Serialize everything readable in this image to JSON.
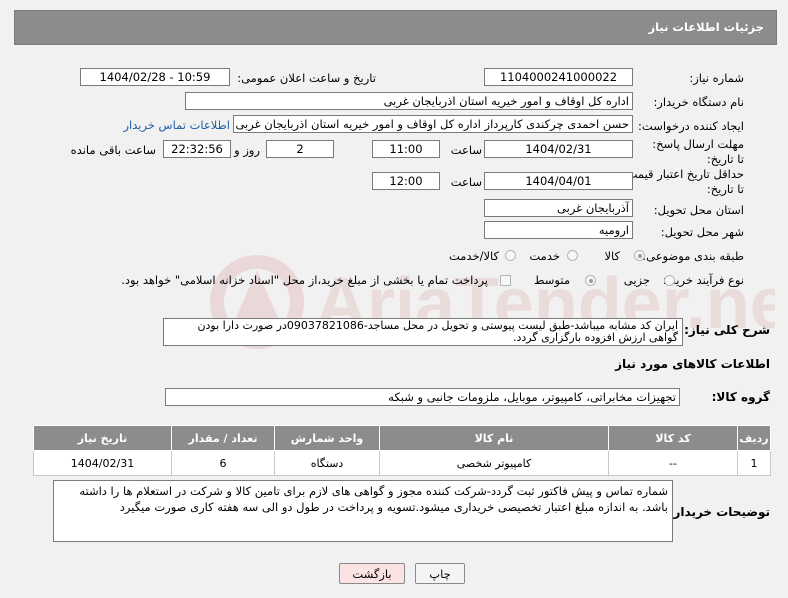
{
  "panel": {
    "title": "جزئیات اطلاعات نیاز"
  },
  "fields": {
    "need_number_label": "شماره نیاز:",
    "need_number": "1104000241000022",
    "announce_label": "تاریخ و ساعت اعلان عمومی:",
    "announce_value": "1404/02/28 - 10:59",
    "buyer_org_label": "نام دستگاه خریدار:",
    "buyer_org": "اداره کل اوقاف و امور خیریه استان اذربایجان غربی",
    "creator_label": "ایجاد کننده درخواست:",
    "creator": "حسن احمدی چرکندی کارپرداز اداره کل اوقاف و امور خیریه استان اذربایجان غربی",
    "contact_link": "اطلاعات تماس خریدار",
    "reply_deadline_label": "مهلت ارسال پاسخ: تا تاریخ:",
    "reply_date": "1404/02/31",
    "time_label": "ساعت",
    "reply_time": "11:00",
    "days_value": "2",
    "days_label": "روز و",
    "remaining_time": "22:32:56",
    "remaining_label": "ساعت باقی مانده",
    "price_validity_label": "حداقل تاریخ اعتبار قیمت: تا تاریخ:",
    "price_date": "1404/04/01",
    "price_time": "12:00",
    "province_label": "استان محل تحویل:",
    "province": "آذربایجان غربی",
    "city_label": "شهر محل تحویل:",
    "city": "ارومیه",
    "category_label": "طبقه بندی موضوعی:",
    "category_options": [
      "کالا",
      "خدمت",
      "کالا/خدمت"
    ],
    "process_label": "نوع فرآیند خرید :",
    "process_options": [
      "جزیی",
      "متوسط"
    ],
    "payment_text": "پرداخت تمام یا بخشی از مبلغ خرید،از محل \"اسناد خزانه اسلامی\" خواهد بود."
  },
  "description": {
    "label": "شرح کلی نیاز:",
    "text": "ایران کد مشابه میباشد-طبق لیست پیوستی و تحویل در محل مساجد-09037821086در صورت دارا بودن گواهی ارزش افزوده بارگزاری گردد."
  },
  "goods": {
    "section_title": "اطلاعات کالاهای مورد نیاز",
    "group_label": "گروه کالا:",
    "group_value": "تجهیزات مخابراتی، کامپیوتر، موبایل، ملزومات جانبی و شبکه",
    "columns": [
      "ردیف",
      "کد کالا",
      "نام کالا",
      "واحد شمارش",
      "تعداد / مقدار",
      "تاریخ نیاز"
    ],
    "rows": [
      {
        "row": "1",
        "code": "--",
        "name": "کامپیوتر شخصی",
        "unit": "دستگاه",
        "qty": "6",
        "date": "1404/02/31"
      }
    ]
  },
  "buyer_notes": {
    "label": "توضیحات خریدار:",
    "text": "شماره تماس و پیش فاکتور ثبت گردد-شرکت کننده مجوز و گواهی های لازم برای تامین کالا و شرکت در استعلام ها را داشته باشد. به اندازه مبلغ اعتبار تخصیصی خریداری میشود.تسویه و پرداخت در طول دو الی سه هفته کاری صورت میگیرد"
  },
  "buttons": {
    "print": "چاپ",
    "back": "بازگشت"
  },
  "watermark": {
    "text": "AriaTender.neT"
  },
  "colors": {
    "header": "#8c8c8c",
    "link": "#1e5fa5",
    "back_button_bg": "#fbe3e3",
    "watermark": "#e8d7d7"
  }
}
